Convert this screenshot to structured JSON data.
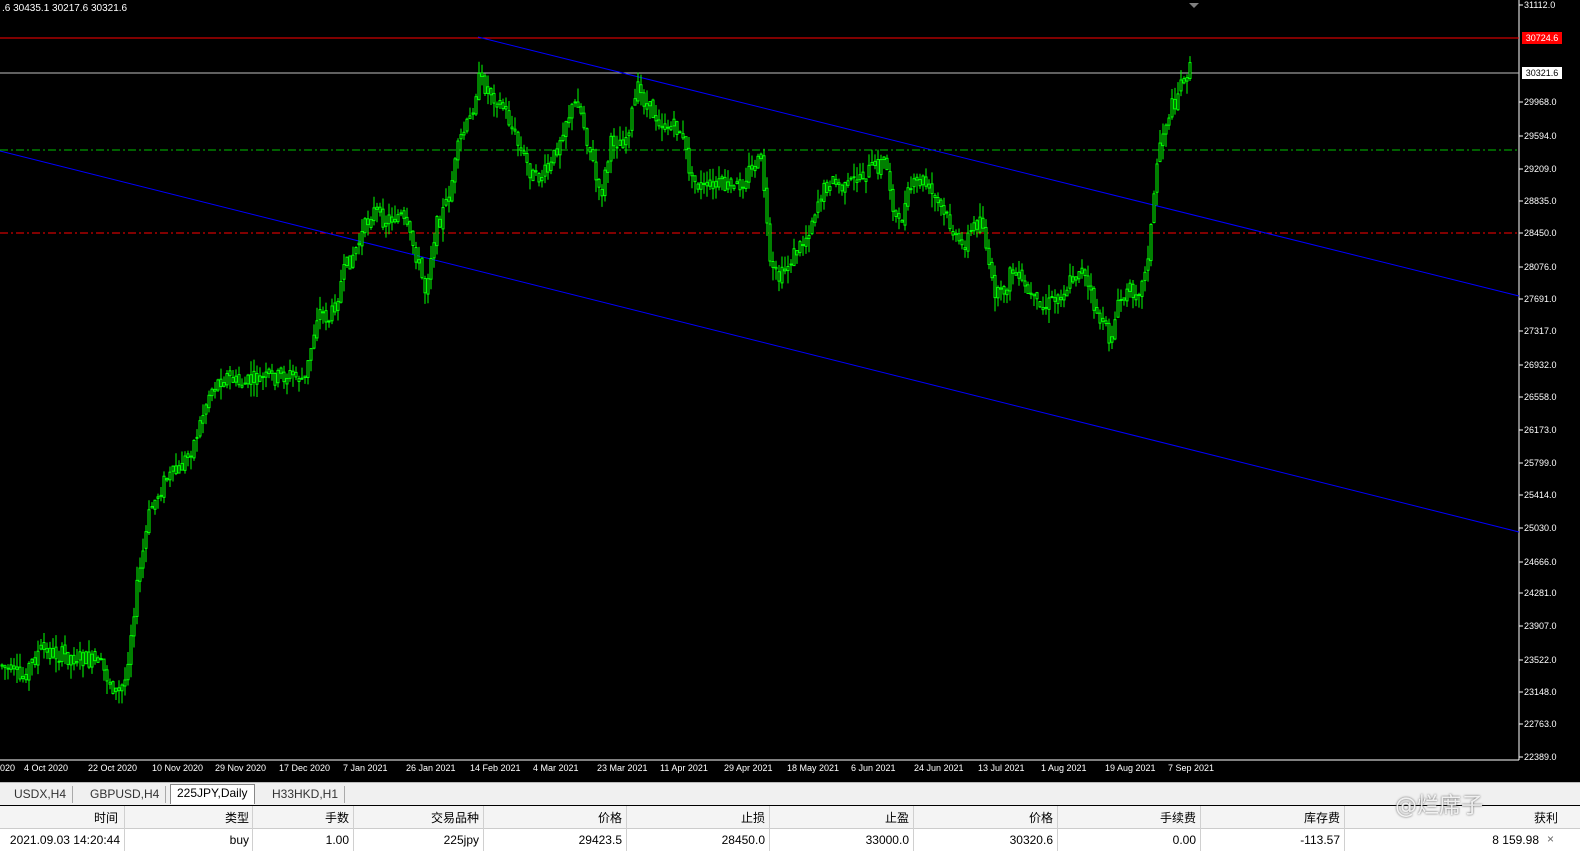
{
  "chart": {
    "ohlc_header": ".6 30435.1 30217.6 30321.6",
    "price_axis": [
      "31112.0",
      "30724.6",
      "30321.6",
      "29968.0",
      "29594.0",
      "29209.0",
      "28835.0",
      "28450.0",
      "28076.0",
      "27691.0",
      "27317.0",
      "26932.0",
      "26558.0",
      "26173.0",
      "25799.0",
      "25414.0",
      "25030.0",
      "24666.0",
      "24281.0",
      "23907.0",
      "23522.0",
      "23148.0",
      "22763.0",
      "22389.0"
    ],
    "red_tag": "30724.6",
    "current_tag": "30321.6",
    "dates": [
      "020",
      "4 Oct 2020",
      "22 Oct 2020",
      "10 Nov 2020",
      "29 Nov 2020",
      "17 Dec 2020",
      "7 Jan 2021",
      "26 Jan 2021",
      "14 Feb 2021",
      "4 Mar 2021",
      "23 Mar 2021",
      "11 Apr 2021",
      "29 Apr 2021",
      "18 May 2021",
      "6 Jun 2021",
      "24 Jun 2021",
      "13 Jul 2021",
      "1 Aug 2021",
      "19 Aug 2021",
      "7 Sep 2021"
    ],
    "colors": {
      "bg": "#000000",
      "candle": "#00ff00",
      "channel": "#0000ff",
      "resistance": "#ff0000",
      "stop_line": "#ff0000",
      "entry_line": "#00c000",
      "current_line": "#c0c0c0"
    }
  },
  "tabs": [
    "USDX,H4",
    "GBPUSD,H4",
    "225JPY,Daily",
    "H33HKD,H1"
  ],
  "active_tab": "225JPY,Daily",
  "table": {
    "headers": [
      "时间",
      "类型",
      "手数",
      "交易品种",
      "价格",
      "止损",
      "止盈",
      "价格",
      "手续费",
      "库存费",
      "获利"
    ],
    "row": [
      "2021.09.03 14:20:44",
      "buy",
      "1.00",
      "225jpy",
      "29423.5",
      "28450.0",
      "33000.0",
      "30320.6",
      "0.00",
      "-113.57",
      "8 159.98"
    ]
  },
  "watermark": "@烂席子",
  "close_icon": "×"
}
